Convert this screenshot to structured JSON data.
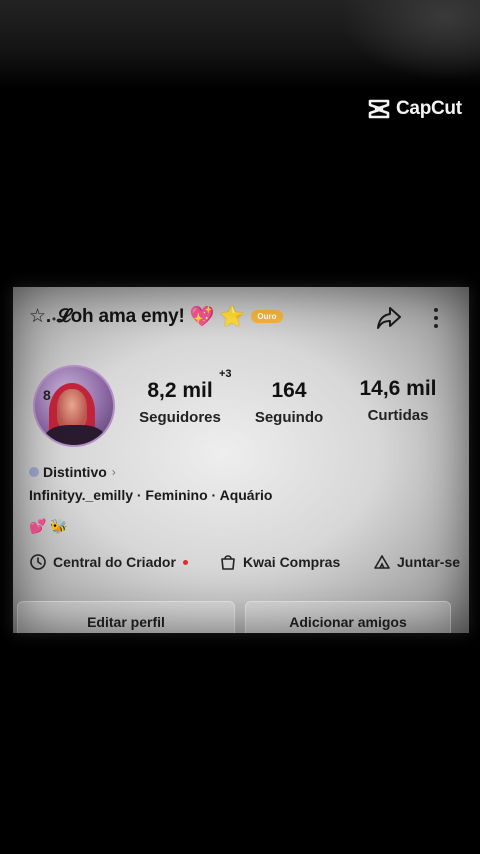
{
  "watermark": {
    "text": "CapCut"
  },
  "profile": {
    "name": "☆.˖𝓛oh ama emy!",
    "heart_emoji": "💖",
    "star_emoji": "⭐",
    "badge": "Ouro",
    "stats": [
      {
        "value": "8,2 mil",
        "label": "Seguidores",
        "extra": "+3"
      },
      {
        "value": "164",
        "label": "Seguindo"
      },
      {
        "value": "14,6 mil",
        "label": "Curtidas"
      }
    ],
    "distintivo": "Distintivo",
    "bio": "Infinityy._emilly · Feminino · Aquário",
    "bio_emojis": [
      "💕",
      "🐝"
    ],
    "links": [
      {
        "label": "Central do Criador",
        "icon": "clock-icon"
      },
      {
        "label": "Kwai Compras",
        "icon": "shopping-bag-icon"
      },
      {
        "label": "Juntar-se",
        "icon": "tent-icon"
      }
    ],
    "buttons": {
      "edit": "Editar perfil",
      "add": "Adicionar amigos"
    }
  },
  "colors": {
    "accent_badge": "#f2b33a",
    "notification_dot": "#e02b2b"
  }
}
